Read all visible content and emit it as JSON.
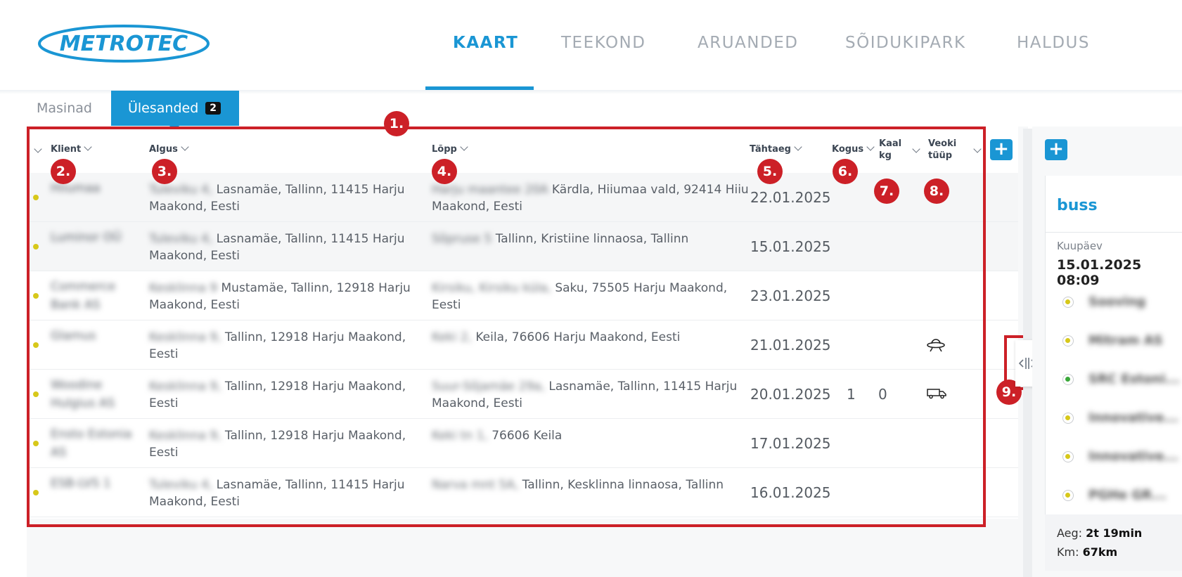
{
  "brand": {
    "name": "METROTEC"
  },
  "nav": [
    {
      "label": "KAART",
      "active": true
    },
    {
      "label": "TEEKOND",
      "active": false
    },
    {
      "label": "ARUANDED",
      "active": false
    },
    {
      "label": "SÕIDUKIPARK",
      "active": false
    },
    {
      "label": "HALDUS",
      "active": false
    }
  ],
  "subtabs": {
    "machines": "Masinad",
    "tasks": "Ülesanded",
    "tasks_count": "2"
  },
  "columns": {
    "client": "Klient",
    "start": "Algus",
    "end": "Lõpp",
    "deadline": "Tähtaeg",
    "quantity": "Kogus",
    "weight_line1": "Kaal",
    "weight_line2": "kg",
    "vehicle_line1": "Veoki",
    "vehicle_line2": "tüüp"
  },
  "rows": [
    {
      "client": "Hiiumaa",
      "start_hidden": "Tuleviku 4,",
      "start_line1": "Lasnamäe, Tallinn, 11415 Harju",
      "start_line2": "Maakond, Eesti",
      "end_hidden": "Harju maantee 20A",
      "end_line1": "Kärdla, Hiiumaa vald, 92414 Hiiu",
      "end_line2": "Maakond, Eesti",
      "deadline": "22.01.2025",
      "quantity": "",
      "weight": "",
      "vehicle": ""
    },
    {
      "client": "Luminor OÜ",
      "start_hidden": "Tuleviku 4,",
      "start_line1": "Lasnamäe, Tallinn, 11415 Harju",
      "start_line2": "Maakond, Eesti",
      "end_hidden": "Sõpruse 5",
      "end_line1": "Tallinn, Kristiine linnaosa, Tallinn",
      "end_line2": "",
      "deadline": "15.01.2025",
      "quantity": "",
      "weight": "",
      "vehicle": ""
    },
    {
      "client": "Commerce Bank AS",
      "start_hidden": "Kesklinna 9",
      "start_line1": "Mustamäe, Tallinn, 12918 Harju",
      "start_line2": "Maakond, Eesti",
      "end_hidden": "Kirsiku, Kirsiku küla,",
      "end_line1": "Saku, 75505 Harju Maakond,",
      "end_line2": "Eesti",
      "deadline": "23.01.2025",
      "quantity": "",
      "weight": "",
      "vehicle": ""
    },
    {
      "client": "Glamus",
      "start_hidden": "Kesklinna 9,",
      "start_line1": "Tallinn, 12918 Harju Maakond, Eesti",
      "start_line2": "",
      "end_hidden": "Keki 2,",
      "end_line1": "Keila, 76606 Harju Maakond, Eesti",
      "end_line2": "",
      "deadline": "21.01.2025",
      "quantity": "",
      "weight": "",
      "vehicle": "ufo-icon"
    },
    {
      "client": "Woodine Hulgius AS",
      "start_hidden": "Kesklinna 9,",
      "start_line1": "Tallinn, 12918 Harju Maakond, Eesti",
      "start_line2": "",
      "end_hidden": "Suur-Sõjamäe 29a,",
      "end_line1": "Lasnamäe, Tallinn, 11415 Harju",
      "end_line2": "Maakond, Eesti",
      "deadline": "20.01.2025",
      "quantity": "1",
      "weight": "0",
      "vehicle": "van-icon"
    },
    {
      "client": "Ensto Estonia AS",
      "start_hidden": "Kesklinna 9,",
      "start_line1": "Tallinn, 12918 Harju Maakond, Eesti",
      "start_line2": "",
      "end_hidden": "Keki tn 1,",
      "end_line1": "76606 Keila",
      "end_line2": "",
      "deadline": "17.01.2025",
      "quantity": "",
      "weight": "",
      "vehicle": ""
    },
    {
      "client": "ESB-LVS 1",
      "start_hidden": "Tuleviku 4,",
      "start_line1": "Lasnamäe, Tallinn, 11415 Harju",
      "start_line2": "Maakond, Eesti",
      "end_hidden": "Narva mnt 5A,",
      "end_line1": "Tallinn, Kesklinna linnaosa, Tallinn",
      "end_line2": "",
      "deadline": "16.01.2025",
      "quantity": "",
      "weight": "",
      "vehicle": ""
    }
  ],
  "markers": [
    "1.",
    "2.",
    "3.",
    "4.",
    "5.",
    "6.",
    "7.",
    "8.",
    "9."
  ],
  "detail": {
    "title": "buss",
    "date_label": "Kuupäev",
    "date_value": "15.01.2025 08:09",
    "stops": [
      {
        "name": "Sooving",
        "color": "#d7c81a"
      },
      {
        "name": "Mitram AS",
        "color": "#d7c81a"
      },
      {
        "name": "SRC Estoni...",
        "color": "#3aa83a"
      },
      {
        "name": "Innovative...",
        "color": "#d7c81a"
      },
      {
        "name": "Innovative...",
        "color": "#d7c81a"
      },
      {
        "name": "PGHe GR...",
        "color": "#d7c81a"
      }
    ],
    "time_label": "Aeg:",
    "time_value": "2t 19min",
    "km_label": "Km:",
    "km_value": "67km"
  },
  "colors": {
    "accent": "#1a96d4",
    "marker": "#cc2027",
    "status_yellow": "#d7c81a",
    "status_green": "#3aa83a"
  }
}
